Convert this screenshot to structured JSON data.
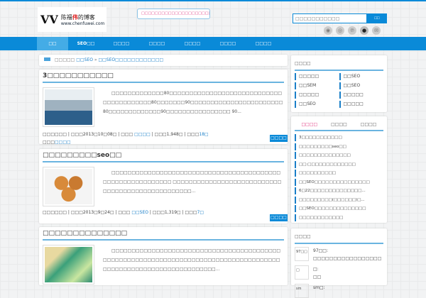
{
  "header": {
    "logo_mark": "VV",
    "logo_name": "陈福伟的博客",
    "logo_name_highlight": "伟",
    "logo_url": "www.chenfuwei.com",
    "notice": "□□□□□□□□□□□□□□□□□□□□□□□□□□□",
    "search_placeholder": "□□□□□□□□□□□",
    "search_button": "□□",
    "social_icons": [
      "rss-icon",
      "weibo-icon",
      "tencent-weibo-icon",
      "qq-icon",
      "email-icon"
    ]
  },
  "nav": [
    "□□",
    "SEO□□",
    "□□□□",
    "□□□□",
    "□□□□",
    "□□□□",
    "□□□□"
  ],
  "breadcrumb": {
    "prefix": "□□□□□",
    "link1": "□□SEO",
    "sep": "»",
    "link2": "□□SEO□□□□□□□□□□□□"
  },
  "posts": [
    {
      "title": "3□□□□□□□□□□□",
      "excerpt": "□□□□□□□□□□□□□80□□□□□□□□□□□□□□□□□□□□□□□□□□□□□□□□□□□□□□□□80□□□□□□□90□□□□□□□□□□□□□□□□□□□□□□□80□□□□□□□□□□□□□90□□□□□□□□□□□□□□□□ 90...",
      "meta": "□□□□□□ | □□□2013□10□08□ | □□□ ",
      "category": "□□□□",
      "views": " | □□□1,948□ | □□□",
      "comments": "18□",
      "tags_label": "□□□",
      "tags": "□□□□",
      "more": "□□□□",
      "thumb": "office"
    },
    {
      "title": "□□□□□□□□□seo□□",
      "excerpt": "□□□□□□□□□□□□□□□□□□□□□□□□□□□□□□□□□□□□□□□□□□□□□□□□□□□□□□□□□□□ □□□□□□□□□□□□□□□□□□□□□□□□□□□□□□□□□□□□□□□□□□□□□□□□□...",
      "meta": "□□□□□□ | □□□2013□9□24□ | □□□ ",
      "category": "□□SEO",
      "views": " | □□□1,319□ | □□□",
      "comments": "7□",
      "more": "□□□□",
      "thumb": "cakes"
    },
    {
      "title": "□□□□□□□□□□□□□□",
      "excerpt": "□□□□□□□□□□□□□□□□□□□□□□□□□□□□□□□□□□□□□□□□□□□□□□□□□□□□□□□□□□□□□□□□□□□□□□□□□□□□□□□□□□□□□□□□□□□□□□□□□□□□□□□□□□□□□□□□□□...",
      "thumb": "bridge"
    }
  ],
  "sidebar": {
    "categories_title": "□□□□",
    "categories": [
      "□□□□□",
      "□□SEO",
      "□□SEM",
      "□□SEO",
      "□□□□□",
      "□□□□□",
      "□□SEO",
      "□□□□□"
    ],
    "tabs": [
      "□□□□",
      "□□□□",
      "□□□□"
    ],
    "hot": [
      "3□□□□□□□□□□□",
      "□□□□□□□□□seo□□",
      "□□□□□□□□□□□□□□",
      "□□:□□□□□□□□□□□□□",
      "□□□□□□□□□□",
      "□□SEO□□□□□□□□□□□□□□□",
      "6□22□□□□□□□□□□□□□□...",
      "□□□□□□□□□(□□□□□□)□...",
      "□□SEO□□□□□□□□□□□□□□",
      "□□□□□□□□□□□□"
    ],
    "comments_title": "□□□□",
    "comments": [
      {
        "avatar": "97□□",
        "name": "97□□:",
        "text": "□□□□□□□□□□□□□□□□□"
      },
      {
        "avatar": "□",
        "name": "□:",
        "text": "□□"
      },
      {
        "avatar": "sm",
        "name": "sm□:",
        "text": ""
      }
    ]
  }
}
